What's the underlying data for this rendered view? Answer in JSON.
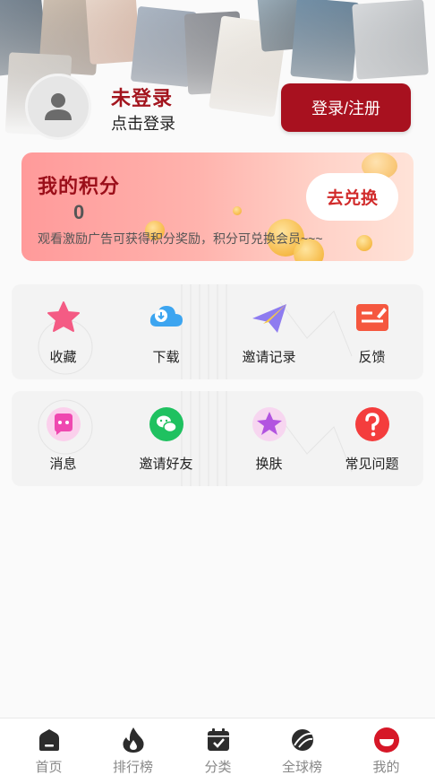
{
  "profile": {
    "name": "未登录",
    "subtitle": "点击登录",
    "login_button": "登录/注册"
  },
  "points": {
    "title": "我的积分",
    "value": "0",
    "description": "观看激励广告可获得积分奖励，积分可兑换会员~~~",
    "redeem_button": "去兑换"
  },
  "grid_row1": [
    {
      "label": "收藏",
      "icon": "star-icon"
    },
    {
      "label": "下载",
      "icon": "cloud-download-icon"
    },
    {
      "label": "邀请记录",
      "icon": "paper-plane-icon"
    },
    {
      "label": "反馈",
      "icon": "feedback-icon"
    }
  ],
  "grid_row2": [
    {
      "label": "消息",
      "icon": "message-icon"
    },
    {
      "label": "邀请好友",
      "icon": "wechat-icon"
    },
    {
      "label": "换肤",
      "icon": "skin-star-icon"
    },
    {
      "label": "常见问题",
      "icon": "question-icon"
    }
  ],
  "tabbar": [
    {
      "label": "首页",
      "icon": "home-icon"
    },
    {
      "label": "排行榜",
      "icon": "flame-icon"
    },
    {
      "label": "分类",
      "icon": "calendar-check-icon"
    },
    {
      "label": "全球榜",
      "icon": "planet-icon"
    },
    {
      "label": "我的",
      "icon": "profile-icon",
      "active": true
    }
  ],
  "colors": {
    "brand_red": "#a8111f",
    "accent_red": "#d12a2a"
  }
}
